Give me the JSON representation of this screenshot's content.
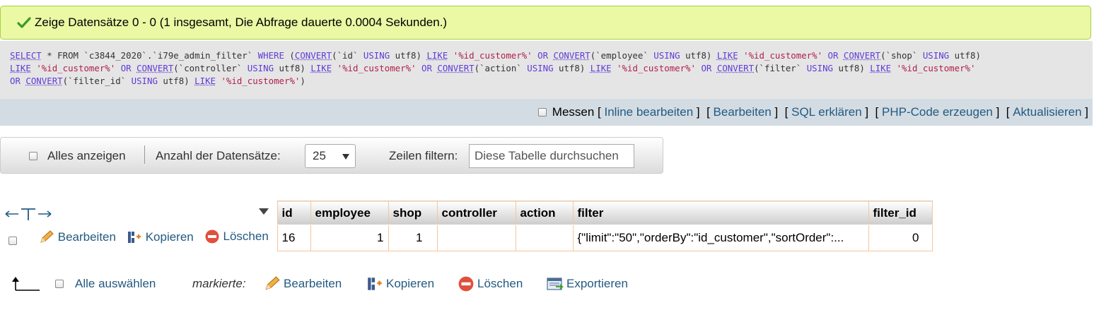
{
  "success": {
    "message": "Zeige Datensätze 0 - 0 (1 insgesamt, Die Abfrage dauerte 0.0004 Sekunden.)",
    "icon": "check-icon"
  },
  "sql": {
    "select": "SELECT",
    "star_from": "* FROM",
    "table": "`c3844_2020`.`i79e_admin_filter`",
    "where": "WHERE",
    "convert": "CONVERT",
    "using": "USING",
    "charset": "utf8",
    "like": "LIKE",
    "or": "OR",
    "pattern": "'%id_customer%'",
    "columns": [
      "`id`",
      "`employee`",
      "`shop`",
      "`controller`",
      "`action`",
      "`filter`",
      "`filter_id`"
    ]
  },
  "sql_tools": {
    "profiling_label": "Messen",
    "links": [
      "Inline bearbeiten",
      "Bearbeiten",
      "SQL erklären",
      "PHP-Code erzeugen",
      "Aktualisieren"
    ]
  },
  "navigation": {
    "show_all_label": "Alles anzeigen",
    "rows_label": "Anzahl der Datensätze:",
    "rows_value": "25",
    "filter_label": "Zeilen filtern:",
    "filter_placeholder": "Diese Tabelle durchsuchen"
  },
  "table": {
    "columns": [
      "id",
      "employee",
      "shop",
      "controller",
      "action",
      "filter",
      "filter_id"
    ],
    "row_actions": {
      "edit": "Bearbeiten",
      "copy": "Kopieren",
      "delete": "Löschen"
    },
    "rows": [
      {
        "id": "16",
        "employee": "1",
        "shop": "1",
        "controller": "",
        "action": "",
        "filter": "{\"limit\":\"50\",\"orderBy\":\"id_customer\",\"sortOrder\":...",
        "filter_id": "0"
      }
    ]
  },
  "bulk": {
    "select_all_label": "Alle auswählen",
    "with_selected_label": "markierte:",
    "edit": "Bearbeiten",
    "copy": "Kopieren",
    "delete": "Löschen",
    "export": "Exportieren"
  },
  "colors": {
    "link": "#235a81",
    "success_bg": "#ebf8a4",
    "success_border": "#a2d246",
    "sql_bg": "#e5e5e5",
    "tools_bg": "#d3dce3",
    "cell_border": "#f4c69d",
    "sql_keyword": "#5f3bd7",
    "sql_string": "#b0204a"
  }
}
